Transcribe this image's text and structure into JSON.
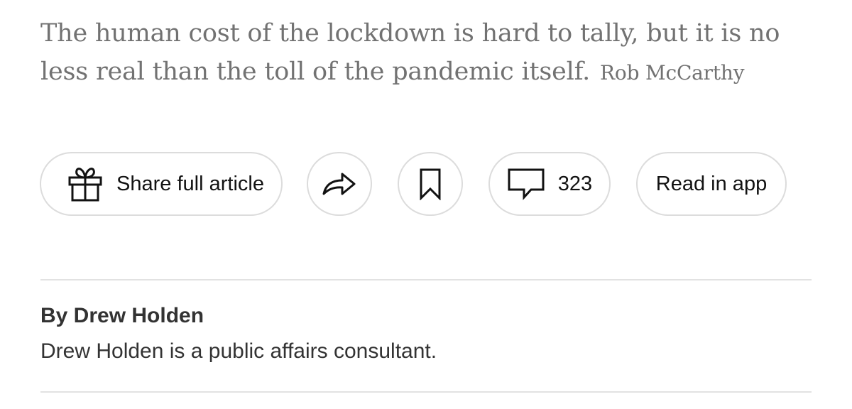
{
  "caption": {
    "text": "The human cost of the lockdown is hard to tally, but it is no less real than the toll of the pandemic itself.",
    "credit": "Rob McCarthy"
  },
  "toolbar": {
    "share_full_label": "Share full article",
    "share_full_icon": "gift-icon",
    "share_icon": "share-arrow-icon",
    "save_icon": "bookmark-icon",
    "comments_icon": "comment-bubble-icon",
    "comments_count": "323",
    "read_in_app_label": "Read in app"
  },
  "author": {
    "byline": "By Drew Holden",
    "bio": "Drew Holden is a public affairs consultant."
  },
  "colors": {
    "caption_text": "#727272",
    "button_border": "#dcdcdc",
    "divider": "#e2e2e2",
    "body_text": "#333333"
  }
}
